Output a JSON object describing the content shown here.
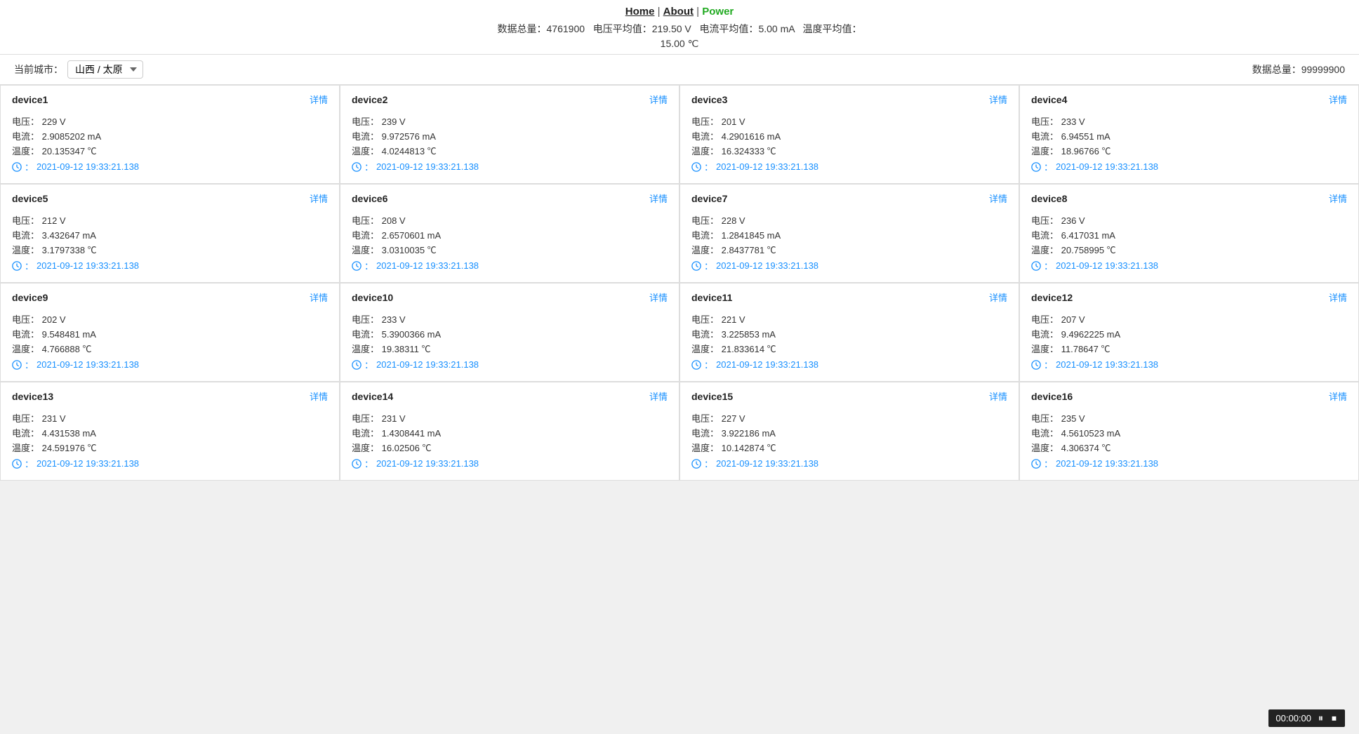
{
  "nav": {
    "home": "Home",
    "separator1": "|",
    "about": "About",
    "separator2": "|",
    "power": "Power"
  },
  "stats": {
    "total_label": "数据总量：",
    "total_value": "4761900",
    "voltage_label": "电压平均值：",
    "voltage_value": "219.50 V",
    "current_label": "电流平均值：",
    "current_value": "5.00 mA",
    "temp_label": "温度平均值：",
    "temp_value": "15.00 ℃",
    "right_total_label": "数据总量：",
    "right_total_value": "99999900"
  },
  "city": {
    "label": "当前城市：",
    "value": "山西 / 太原"
  },
  "detail_label": "详情",
  "devices": [
    {
      "name": "device1",
      "voltage": "电压：  229 V",
      "current": "电流：  2.9085202 mA",
      "temp": "温度：  20.135347 ℃",
      "time": "2021-09-12 19:33:21.138"
    },
    {
      "name": "device2",
      "voltage": "电压：  239 V",
      "current": "电流：  9.972576 mA",
      "temp": "温度：  4.0244813 ℃",
      "time": "2021-09-12 19:33:21.138"
    },
    {
      "name": "device3",
      "voltage": "电压：  201 V",
      "current": "电流：  4.2901616 mA",
      "temp": "温度：  16.324333 ℃",
      "time": "2021-09-12 19:33:21.138"
    },
    {
      "name": "device4",
      "voltage": "电压：  233 V",
      "current": "电流：  6.94551 mA",
      "temp": "温度：  18.96766 ℃",
      "time": "2021-09-12 19:33:21.138"
    },
    {
      "name": "device5",
      "voltage": "电压：  212 V",
      "current": "电流：  3.432647 mA",
      "temp": "温度：  3.1797338 ℃",
      "time": "2021-09-12 19:33:21.138"
    },
    {
      "name": "device6",
      "voltage": "电压：  208 V",
      "current": "电流：  2.6570601 mA",
      "temp": "温度：  3.0310035 ℃",
      "time": "2021-09-12 19:33:21.138"
    },
    {
      "name": "device7",
      "voltage": "电压：  228 V",
      "current": "电流：  1.2841845 mA",
      "temp": "温度：  2.8437781 ℃",
      "time": "2021-09-12 19:33:21.138"
    },
    {
      "name": "device8",
      "voltage": "电压：  236 V",
      "current": "电流：  6.417031 mA",
      "temp": "温度：  20.758995 ℃",
      "time": "2021-09-12 19:33:21.138"
    },
    {
      "name": "device9",
      "voltage": "电压：  202 V",
      "current": "电流：  9.548481 mA",
      "temp": "温度：  4.766888 ℃",
      "time": "2021-09-12 19:33:21.138"
    },
    {
      "name": "device10",
      "voltage": "电压：  233 V",
      "current": "电流：  5.3900366 mA",
      "temp": "温度：  19.38311 ℃",
      "time": "2021-09-12 19:33:21.138"
    },
    {
      "name": "device11",
      "voltage": "电压：  221 V",
      "current": "电流：  3.225853 mA",
      "temp": "温度：  21.833614 ℃",
      "time": "2021-09-12 19:33:21.138"
    },
    {
      "name": "device12",
      "voltage": "电压：  207 V",
      "current": "电流：  9.4962225 mA",
      "temp": "温度：  11.78647 ℃",
      "time": "2021-09-12 19:33:21.138"
    },
    {
      "name": "device13",
      "voltage": "电压：  231 V",
      "current": "电流：  4.431538 mA",
      "temp": "温度：  24.591976 ℃",
      "time": "2021-09-12 19:33:21.138"
    },
    {
      "name": "device14",
      "voltage": "电压：  231 V",
      "current": "电流：  1.4308441 mA",
      "temp": "温度：  16.02506 ℃",
      "time": "2021-09-12 19:33:21.138"
    },
    {
      "name": "device15",
      "voltage": "电压：  227 V",
      "current": "电流：  3.922186 mA",
      "temp": "温度：  10.142874 ℃",
      "time": "2021-09-12 19:33:21.138"
    },
    {
      "name": "device16",
      "voltage": "电压：  235 V",
      "current": "电流：  4.5610523 mA",
      "temp": "温度：  4.306374 ℃",
      "time": "2021-09-12 19:33:21.138"
    }
  ],
  "timer": {
    "display": "00:00:00"
  }
}
